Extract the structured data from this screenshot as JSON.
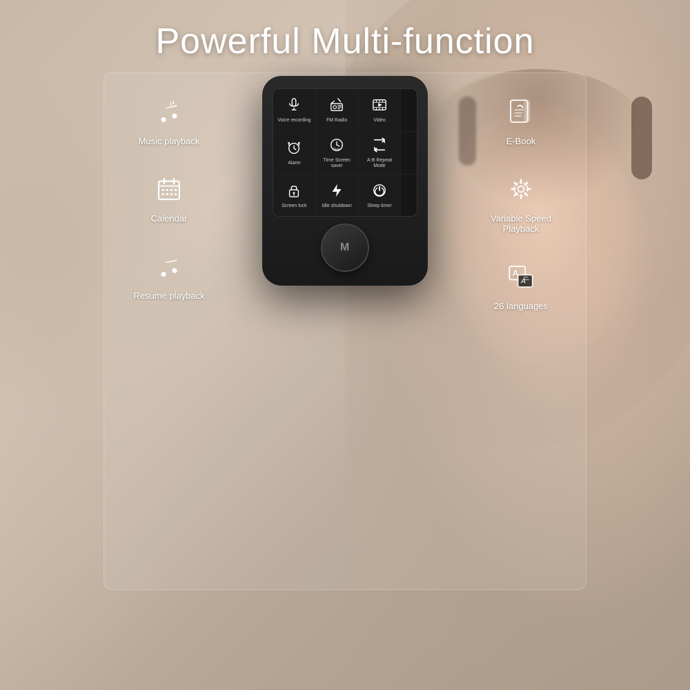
{
  "title": "Powerful Multi-function",
  "features_left": [
    {
      "id": "music-playback",
      "label": "Music playback",
      "icon": "music"
    },
    {
      "id": "calendar",
      "label": "Calendar",
      "icon": "calendar"
    },
    {
      "id": "resume-playback",
      "label": "Resume playback",
      "icon": "resume"
    }
  ],
  "features_right": [
    {
      "id": "ebook",
      "label": "E-Book",
      "icon": "book"
    },
    {
      "id": "variable-speed",
      "label": "Variable Speed Playback",
      "icon": "gear"
    },
    {
      "id": "languages",
      "label": "26 languages",
      "icon": "translate"
    }
  ],
  "screen_items": [
    {
      "id": "voice-recording",
      "label": "Voice recording",
      "icon": "mic"
    },
    {
      "id": "fm-radio",
      "label": "FM Radio",
      "icon": "radio"
    },
    {
      "id": "video",
      "label": "Video",
      "icon": "video"
    },
    {
      "id": "alarm",
      "label": "Alarm",
      "icon": "alarm"
    },
    {
      "id": "time-screen-saver",
      "label": "Time Screen saver",
      "icon": "time"
    },
    {
      "id": "ab-repeat",
      "label": "A-B Repeat Mode",
      "icon": "repeat"
    },
    {
      "id": "screen-lock",
      "label": "Screen lock",
      "icon": "lock"
    },
    {
      "id": "idle-shutdown",
      "label": "Idle shutdown",
      "icon": "lightning"
    },
    {
      "id": "sleep-timer",
      "label": "Sleep timer",
      "icon": "power"
    }
  ],
  "device": {
    "nav_button_label": "M"
  },
  "colors": {
    "bg": "#b8a898",
    "device": "#1a1a1a",
    "screen_bg": "#111",
    "text_white": "#ffffff",
    "accent": "#ffffff"
  }
}
